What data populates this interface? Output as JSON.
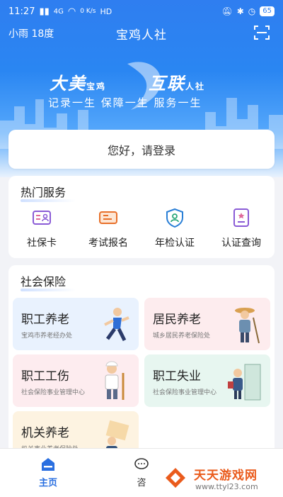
{
  "status_bar": {
    "time": "11:27",
    "network": "4G",
    "speed": "0 K/s",
    "hd": "HD",
    "battery": "65"
  },
  "top_bar": {
    "weather": "小雨 18度",
    "title": "宝鸡人社",
    "scan_icon": "scan-icon"
  },
  "banner": {
    "slogan_left_big": "大美",
    "slogan_left_small": "宝鸡",
    "slogan_right_big": "互联",
    "slogan_right_small": "人社",
    "motto": "记录一生  保障一生  服务一生"
  },
  "login": {
    "prompt": "您好，请登录"
  },
  "hot_services": {
    "title": "热门服务",
    "items": [
      {
        "label": "社保卡",
        "icon": "id-card-icon",
        "color": "#8a5bd6"
      },
      {
        "label": "考试报名",
        "icon": "exam-ticket-icon",
        "color": "#e8702a"
      },
      {
        "label": "年检认证",
        "icon": "shield-person-icon",
        "color": "#2a7fd6"
      },
      {
        "label": "认证查询",
        "icon": "certificate-icon",
        "color": "#8a5bd6"
      }
    ]
  },
  "social_insurance": {
    "title": "社会保险",
    "tiles": [
      {
        "title": "职工养老",
        "subtitle": "宝鸡市养老经办处"
      },
      {
        "title": "居民养老",
        "subtitle": "城乡居民养老保险处"
      },
      {
        "title": "职工工伤",
        "subtitle": "社会保险事业管理中心"
      },
      {
        "title": "职工失业",
        "subtitle": "社会保险事业管理中心"
      },
      {
        "title": "机关养老",
        "subtitle": "机关事业养老保险处"
      }
    ]
  },
  "tab_bar": {
    "items": [
      {
        "label": "主页",
        "icon": "home-icon",
        "active": true
      },
      {
        "label": "咨",
        "icon": "chat-icon",
        "active": false
      }
    ]
  },
  "watermark": {
    "name": "天天游戏网",
    "url": "www.ttyl23.com"
  },
  "colors": {
    "primary": "#2f7ef0",
    "active_tab": "#2a6fe0"
  }
}
